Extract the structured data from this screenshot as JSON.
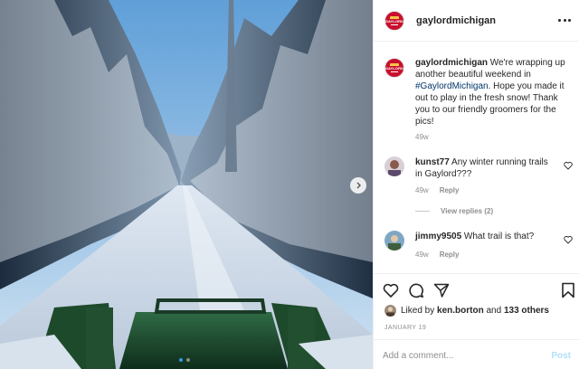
{
  "post": {
    "account": "gaylordmichigan",
    "logo_text": "GAYLORD",
    "caption": {
      "username": "gaylordmichigan",
      "text_before": " We're wrapping up another beautiful weekend in ",
      "hashtag": "#GaylordMichigan",
      "text_after": ". Hope you made it out to play in the fresh snow! Thank you to our friendly groomers for the pics!",
      "age": "49w"
    },
    "comments": [
      {
        "username": "kunst77",
        "text": " Any winter running trails in Gaylord???",
        "age": "49w",
        "reply_label": "Reply",
        "view_replies": "View replies (2)"
      },
      {
        "username": "jimmy9505",
        "text": " What trail is that?",
        "age": "49w",
        "reply_label": "Reply"
      }
    ],
    "likes": {
      "prefix": "Liked by ",
      "user": "ken.borton",
      "middle": " and ",
      "others": "133 others"
    },
    "date": "JANUARY 19",
    "add_comment": {
      "placeholder": "Add a comment...",
      "post_label": "Post"
    },
    "carousel": {
      "slides": 2,
      "active": 1
    },
    "colors": {
      "link": "#00376b",
      "post_button": "#b2dffc",
      "muted": "#8e8e8e",
      "brand_red": "#c8102e"
    },
    "icons": [
      "next-arrow-icon",
      "more-options-icon",
      "heart-icon",
      "comment-icon",
      "share-icon",
      "bookmark-icon"
    ]
  }
}
